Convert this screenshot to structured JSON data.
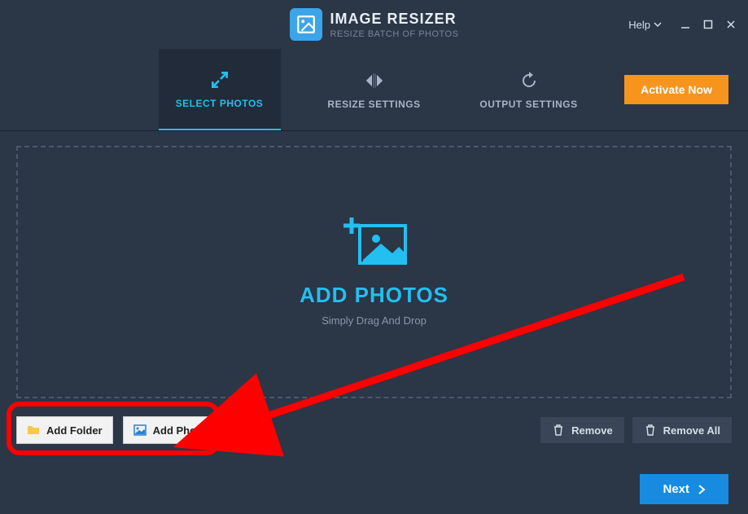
{
  "titlebar": {
    "app_name": "IMAGE RESIZER",
    "tagline": "RESIZE BATCH OF PHOTOS",
    "help_label": "Help"
  },
  "tabs": {
    "select": "SELECT PHOTOS",
    "resize": "RESIZE SETTINGS",
    "output": "OUTPUT SETTINGS"
  },
  "activate": {
    "label": "Activate Now"
  },
  "drop": {
    "title": "ADD PHOTOS",
    "subtitle": "Simply Drag And Drop"
  },
  "actions": {
    "add_folder": "Add Folder",
    "add_photos": "Add Photos",
    "remove": "Remove",
    "remove_all": "Remove All"
  },
  "footer": {
    "next": "Next"
  }
}
